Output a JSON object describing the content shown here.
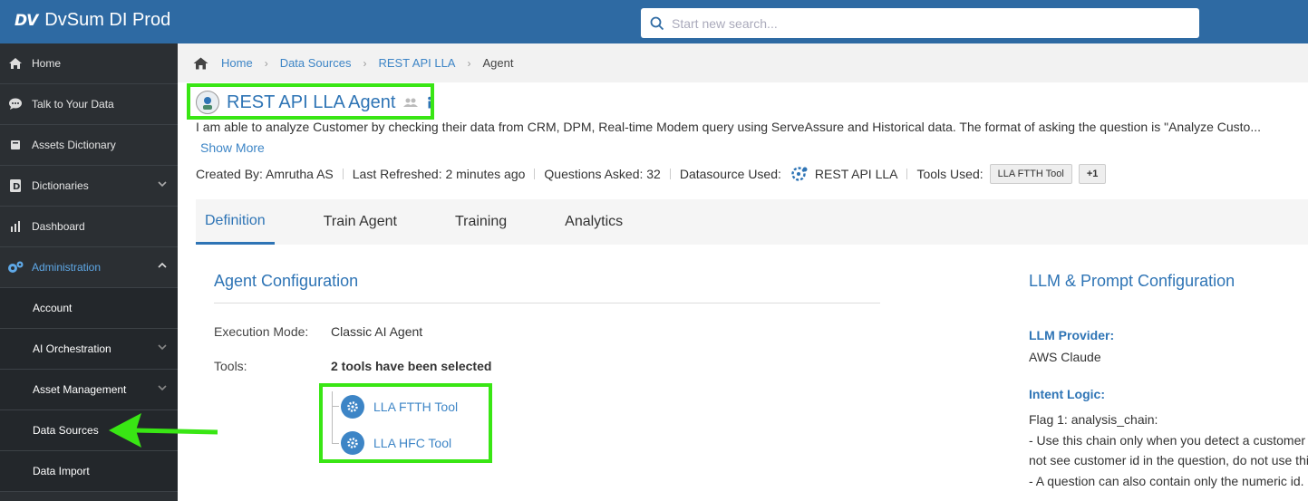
{
  "app": {
    "logo_mark": "DV",
    "title": "DvSum DI Prod"
  },
  "search": {
    "placeholder": "Start new search..."
  },
  "sidebar": {
    "items": [
      {
        "label": "Home",
        "icon": "home-icon"
      },
      {
        "label": "Talk to Your Data",
        "icon": "chat-icon"
      },
      {
        "label": "Assets Dictionary",
        "icon": "book-icon"
      },
      {
        "label": "Dictionaries",
        "icon": "dictionary-icon"
      },
      {
        "label": "Dashboard",
        "icon": "bar-chart-icon"
      },
      {
        "label": "Administration",
        "icon": "gears-icon"
      }
    ],
    "sub_items": [
      {
        "label": "Account"
      },
      {
        "label": "AI Orchestration"
      },
      {
        "label": "Asset Management"
      },
      {
        "label": "Data Sources"
      },
      {
        "label": "Data Import"
      }
    ]
  },
  "breadcrumb": {
    "home": "Home",
    "data_sources": "Data Sources",
    "rest_api": "REST API LLA",
    "current": "Agent"
  },
  "header": {
    "title": "REST API LLA Agent",
    "description": "I am able to analyze Customer by checking their data from CRM, DPM, Real-time Modem query using ServeAssure and Historical data. The format of asking the question is \"Analyze Custo...",
    "show_more": "Show More"
  },
  "meta": {
    "created_by": "Created By: Amrutha AS",
    "last_refreshed": "Last Refreshed: 2 minutes ago",
    "questions_asked": "Questions Asked: 32",
    "datasource_label": "Datasource Used:",
    "datasource_value": "REST API LLA",
    "tools_label": "Tools Used:",
    "tool_chip": "LLA FTTH Tool",
    "more_chip": "+1"
  },
  "tabs": [
    "Definition",
    "Train Agent",
    "Training",
    "Analytics"
  ],
  "agent_config": {
    "title": "Agent Configuration",
    "execution_mode_label": "Execution Mode:",
    "execution_mode_value": "Classic AI Agent",
    "tools_label": "Tools:",
    "tools_value": "2 tools have been selected",
    "tools": [
      "LLA FTTH Tool",
      "LLA HFC Tool"
    ]
  },
  "llm_config": {
    "title": "LLM & Prompt Configuration",
    "provider_label": "LLM Provider:",
    "provider_value": "AWS Claude",
    "intent_label": "Intent Logic:",
    "intent_lines": [
      "Flag 1: analysis_chain:",
      "- Use this chain only when you detect a customer",
      "not see customer id in the question, do not use thi",
      "- A question can also contain only the numeric id."
    ]
  },
  "colors": {
    "topbar": "#2e6aa3",
    "sidebar": "#2b2f33",
    "accent": "#2e74b5",
    "highlight": "#39e614"
  }
}
